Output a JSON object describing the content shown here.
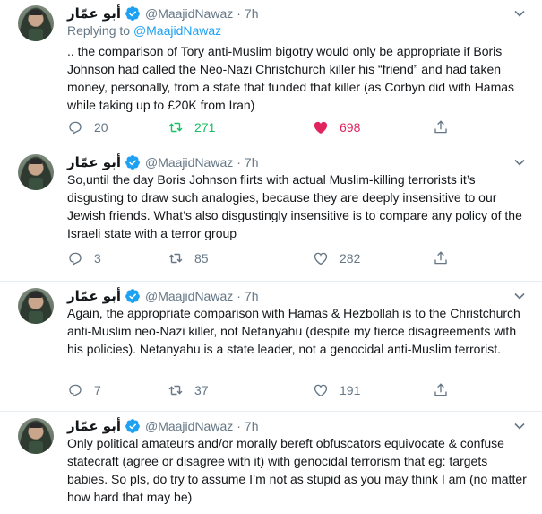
{
  "colors": {
    "link": "#1da1f2",
    "muted": "#657786",
    "retweet_active": "#17bf63",
    "like_active": "#e0245e",
    "verified": "#1da1f2"
  },
  "tweets": [
    {
      "name": "أبو عمّار",
      "handle": "@MaajidNawaz",
      "separator": "·",
      "time": "7h",
      "replying_prefix": "Replying to ",
      "replying_to": "@MaajidNawaz",
      "text": ".. the comparison of Tory anti-Muslim bigotry would only be appropriate if Boris Johnson had called the Neo-Nazi Christchurch killer his “friend” and had taken money, personally, from a state that funded that killer (as Corbyn did with Hamas while taking up to £20K from Iran)",
      "replies": "20",
      "retweets": "271",
      "likes": "698"
    },
    {
      "name": "أبو عمّار",
      "handle": "@MaajidNawaz",
      "separator": "·",
      "time": "7h",
      "text": "So,until the day Boris Johnson flirts with actual Muslim-killing terrorists it’s disgusting to draw such analogies, because they are deeply insensitive to our Jewish friends. What’s also disgustingly insensitive is to compare any policy of the Israeli state with a terror group",
      "replies": "3",
      "retweets": "85",
      "likes": "282"
    },
    {
      "name": "أبو عمّار",
      "handle": "@MaajidNawaz",
      "separator": "·",
      "time": "7h",
      "text": "Again, the appropriate comparison with Hamas & Hezbollah is to the Christchurch anti-Muslim neo-Nazi killer, not Netanyahu (despite my fierce disagreements with his policies). Netanyahu is a state leader, not a genocidal anti-Muslim terrorist.",
      "replies": "7",
      "retweets": "37",
      "likes": "191"
    },
    {
      "name": "أبو عمّار",
      "handle": "@MaajidNawaz",
      "separator": "·",
      "time": "7h",
      "text": "Only political amateurs and/or morally bereft obfuscators equivocate & confuse statecraft (agree or disagree with it) with genocidal terrorism that eg: targets babies. So pls, do try to assume I’m not as stupid as you may think I am (no matter how hard that may be)"
    }
  ]
}
